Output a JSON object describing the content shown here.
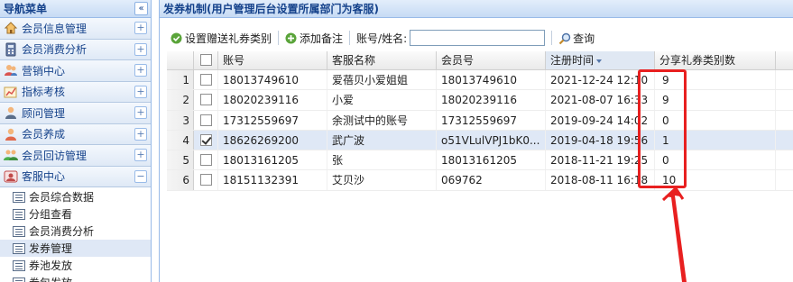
{
  "sidebar": {
    "title": "导航菜单",
    "collapse_glyph": "«",
    "sections": [
      {
        "label": "会员信息管理",
        "icon": "home-icon",
        "toggle": "+"
      },
      {
        "label": "会员消费分析",
        "icon": "calculator-icon",
        "toggle": "+"
      },
      {
        "label": "营销中心",
        "icon": "users-icon",
        "toggle": "+"
      },
      {
        "label": "指标考核",
        "icon": "chart-icon",
        "toggle": "+"
      },
      {
        "label": "顾问管理",
        "icon": "consultant-icon",
        "toggle": "+"
      },
      {
        "label": "会员养成",
        "icon": "member-icon",
        "toggle": "+"
      },
      {
        "label": "会员回访管理",
        "icon": "group-icon",
        "toggle": "+"
      },
      {
        "label": "客服中心",
        "icon": "service-icon",
        "toggle": "−"
      }
    ],
    "sub_items": [
      {
        "label": "会员综合数据",
        "active": false
      },
      {
        "label": "分组查看",
        "active": false
      },
      {
        "label": "会员消费分析",
        "active": false
      },
      {
        "label": "发券管理",
        "active": true
      },
      {
        "label": "券池发放",
        "active": false
      },
      {
        "label": "券包发放",
        "active": false
      }
    ]
  },
  "main": {
    "title": "发券机制(用户管理后台设置所属部门为客服)",
    "toolbar": {
      "set_label": "设置赠送礼券类别",
      "add_note_label": "添加备注",
      "search_label": "账号/姓名:",
      "search_value": "",
      "query_label": "查询"
    },
    "grid": {
      "columns": [
        "账号",
        "客服名称",
        "会员号",
        "注册时间",
        "分享礼券类别数"
      ],
      "rows": [
        {
          "num": "1",
          "checked": false,
          "account": "18013749610",
          "name": "爱蓓贝小爱姐姐",
          "member": "18013749610",
          "time": "2021-12-24 12:10",
          "count": "9"
        },
        {
          "num": "2",
          "checked": false,
          "account": "18020239116",
          "name": "小爱",
          "member": "18020239116",
          "time": "2021-08-07 16:33",
          "count": "9"
        },
        {
          "num": "3",
          "checked": false,
          "account": "17312559697",
          "name": "余测试中的账号",
          "member": "17312559697",
          "time": "2019-09-24 14:02",
          "count": "0"
        },
        {
          "num": "4",
          "checked": true,
          "account": "18626269200",
          "name": "武广波",
          "member": "o51VLulVPJ1bK0...",
          "time": "2019-04-18 19:56",
          "count": "1"
        },
        {
          "num": "5",
          "checked": false,
          "account": "18013161205",
          "name": "张",
          "member": "18013161205",
          "time": "2018-11-21 19:25",
          "count": "0"
        },
        {
          "num": "6",
          "checked": false,
          "account": "18151132391",
          "name": "艾贝沙",
          "member": "069762",
          "time": "2018-08-11 16:18",
          "count": "10"
        }
      ]
    }
  },
  "colors": {
    "accent": "#15428b",
    "border": "#99bbe8",
    "annotation": "#e82020"
  }
}
